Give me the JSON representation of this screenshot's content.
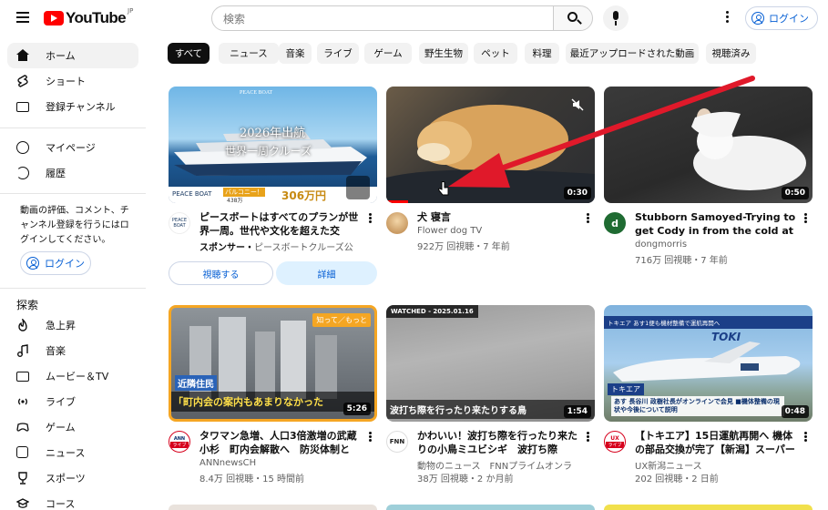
{
  "header": {
    "logo_text": "YouTube",
    "logo_region": "JP",
    "search_placeholder": "検索",
    "login_label": "ログイン"
  },
  "sidebar": {
    "main": [
      {
        "label": "ホーム",
        "icon": "home-icon"
      },
      {
        "label": "ショート",
        "icon": "shorts-icon"
      },
      {
        "label": "登録チャンネル",
        "icon": "subscriptions-icon"
      }
    ],
    "you": [
      {
        "label": "マイページ",
        "icon": "profile-icon"
      },
      {
        "label": "履歴",
        "icon": "history-icon"
      }
    ],
    "signin_note": "動画の評価、コメント、チャンネル登録を行うにはログインしてください。",
    "signin_button": "ログイン",
    "explore_heading": "探索",
    "explore": [
      {
        "label": "急上昇",
        "icon": "trending-icon"
      },
      {
        "label": "音楽",
        "icon": "music-icon"
      },
      {
        "label": "ムービー＆TV",
        "icon": "movies-icon"
      },
      {
        "label": "ライブ",
        "icon": "live-icon"
      },
      {
        "label": "ゲーム",
        "icon": "gaming-icon"
      },
      {
        "label": "ニュース",
        "icon": "news-icon"
      },
      {
        "label": "スポーツ",
        "icon": "sports-icon"
      },
      {
        "label": "コース",
        "icon": "course-icon"
      }
    ]
  },
  "chips": [
    "すべて",
    "ニュース",
    "音楽",
    "ライブ",
    "ゲーム",
    "野生生物",
    "ペット",
    "料理",
    "最近アップロードされた動画",
    "視聴済み"
  ],
  "videos": [
    {
      "title": "ピースボートはすべてのプランが世界一周。世代や文化を超えた交",
      "channel": "ピースボートクルーズ公",
      "sponsor_label": "スポンサー・",
      "thumb_text_1": "PEACE BOAT",
      "thumb_text_2": "2026年出航",
      "thumb_text_3": "世界一周クルーズ",
      "thumb_price": "306万円",
      "thumb_badge": "バルコニー！",
      "thumb_price_sub": "438万",
      "watch_button": "視聴する",
      "details_button": "詳細"
    },
    {
      "title": "犬 寝言",
      "channel": "Flower dog TV",
      "meta": "922万 回視聴・7 年前",
      "duration": "0:30"
    },
    {
      "title": "Stubborn Samoyed-Trying to get Cody in from the cold at bedtime.",
      "channel": "dongmorris",
      "meta": "716万 回視聴・7 年前",
      "duration": "0:50",
      "avatar_letter": "d"
    },
    {
      "title": "タワマン急増、人口3倍激増の武蔵小杉　町内会解散へ　防災体制と",
      "channel": "ANNnewsCH",
      "meta": "8.4万 回視聴・15 時間前",
      "duration": "5:26",
      "thumb_tag": "知って／もっと",
      "thumb_caption_1": "近隣住民",
      "thumb_caption_2": "「町内会の案内もあまりなかった",
      "avatar_text_1": "ANN",
      "avatar_text_2": "ライブ"
    },
    {
      "title": "かわいい！波打ち際を行ったり来たりの小鳥ミユビシギ　波打ち際",
      "channel": "動物のニュース　FNNプライムオンラ",
      "meta": "38万 回視聴・2 か月前",
      "duration": "1:54",
      "watched_label": "WATCHED - 2025.01.16",
      "thumb_caption": "波打ち際を行ったり来たりする鳥",
      "avatar_text": "FNN"
    },
    {
      "title": "【トキエア】15日運航再開へ 機体の部品交換が完了【新潟】スーパー",
      "channel": "UX新潟ニュース",
      "meta": "202 回視聴・2 日前",
      "duration": "0:48",
      "thumb_banner_1": "トキエア あす1便も機材整備で運航再開へ",
      "thumb_brand": "TOKI",
      "thumb_tag": "トキエア",
      "thumb_caption": "あす 長谷川 政樹社長がオンラインで会見 ■機体整備の現状や今後について説明",
      "avatar_text_1": "UX",
      "avatar_text_2": "ライブ"
    }
  ],
  "colors": {
    "brand_red": "#ff0000",
    "link_blue": "#065fd4",
    "annotation_arrow": "#e0192a"
  }
}
